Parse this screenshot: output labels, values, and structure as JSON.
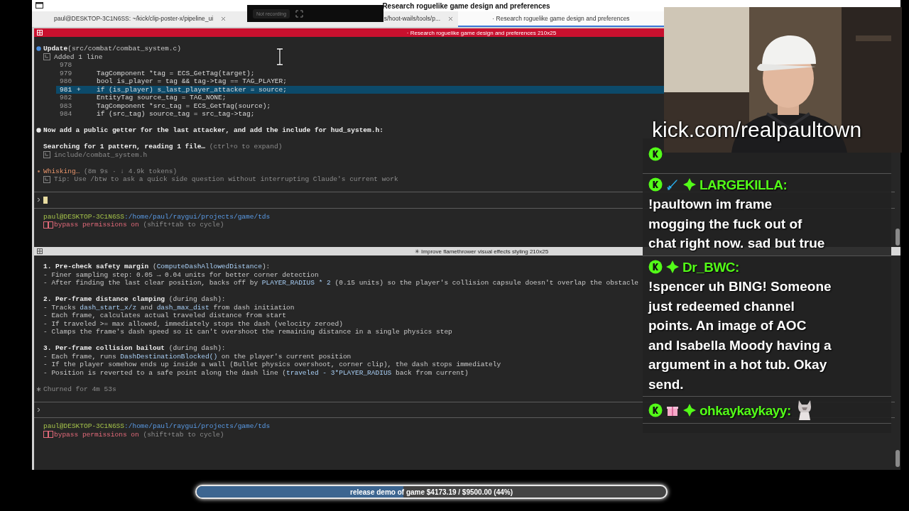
{
  "window": {
    "title": "Research roguelike game design and preferences"
  },
  "tabs": [
    {
      "label": "paul@DESKTOP-3C1N6SS: ~/kick/clip-poster-x/pipeline_ui",
      "selected": false
    },
    {
      "label": "s/hoot-wails/tools/p...",
      "selected": false
    },
    {
      "label": "· Research roguelike game design and preferences",
      "selected": true
    }
  ],
  "recorder": {
    "label": "Not recording"
  },
  "panes": [
    {
      "header": {
        "title": "· Research roguelike game design and preferences 210x25",
        "active": true
      },
      "lines": [
        {
          "kind": "text",
          "bullet": {
            "kind": "tool"
          },
          "segs": [
            {
              "text": "Update",
              "kind": "bold"
            },
            {
              "text": "(src/combat/combat_system.c)",
              "kind": "plain"
            }
          ]
        },
        {
          "kind": "sub",
          "segs": [
            {
              "text": "Added 1 line",
              "kind": "plain"
            }
          ]
        },
        {
          "kind": "diff",
          "num": "978",
          "added": false
        },
        {
          "kind": "diff",
          "num": "979",
          "code": "TagComponent *tag = ECS_GetTag(target);",
          "added": false
        },
        {
          "kind": "diff",
          "num": "980",
          "code": "bool is_player = tag && tag->tag == TAG_PLAYER;",
          "added": false
        },
        {
          "kind": "diff",
          "num": "981",
          "sign": "+",
          "code": "if (is_player) s_last_player_attacker = source;",
          "added": true
        },
        {
          "kind": "diff",
          "num": "982",
          "code": "EntityTag source_tag = TAG_NONE;",
          "added": false
        },
        {
          "kind": "diff",
          "num": "983",
          "code": "TagComponent *src_tag = ECS_GetTag(source);",
          "added": false
        },
        {
          "kind": "diff",
          "num": "984",
          "code": "if (src_tag) source_tag = src_tag->tag;",
          "added": false
        },
        {
          "kind": "blank"
        },
        {
          "kind": "text",
          "bullet": {
            "kind": "reply"
          },
          "segs": [
            {
              "text": "Now add a public getter for the last attacker, and add the include for hud_system.h:",
              "kind": "bold"
            }
          ]
        },
        {
          "kind": "blank"
        },
        {
          "kind": "text",
          "segs": [
            {
              "text": "Searching for 1 pattern, reading 1 file…",
              "kind": "bold"
            },
            {
              "text": " (ctrl+o to expand)",
              "kind": "dim"
            }
          ]
        },
        {
          "kind": "sub",
          "segs": [
            {
              "text": "include/combat_system.h",
              "kind": "dim"
            }
          ]
        },
        {
          "kind": "blank"
        },
        {
          "kind": "text",
          "bullet": {
            "kind": "working"
          },
          "segs": [
            {
              "text": "Whisking…",
              "kind": "warn"
            },
            {
              "text": " (8m 9s · ↓ 4.9k tokens)",
              "kind": "dim"
            }
          ]
        },
        {
          "kind": "sub",
          "segs": [
            {
              "text": "Tip: Use /btw to ask a quick side question without interrupting Claude's current work",
              "kind": "dim"
            }
          ]
        },
        {
          "kind": "blank"
        }
      ],
      "input": {
        "cursor": true
      },
      "prompt": [
        {
          "text": "paul@DESKTOP-3C1N6SS",
          "kind": "host"
        },
        {
          "text": ":/home/paul/raygui/projects/game/tds",
          "kind": "path"
        }
      ],
      "mode": [
        {
          "text": "bypass permissions on",
          "kind": "alert"
        },
        {
          "text": " (shift+tab to cycle)",
          "kind": "dim"
        }
      ]
    },
    {
      "header": {
        "title": "✳ Improve flamethrower visual effects styling 210x25",
        "active": false
      },
      "lines": [
        {
          "kind": "text",
          "segs": [
            {
              "text": "1. Pre-check safety margin",
              "kind": "bold"
            },
            {
              "text": " (",
              "kind": "plain"
            },
            {
              "text": "ComputeDashAllowedDistance",
              "kind": "ident"
            },
            {
              "text": "):",
              "kind": "plain"
            }
          ]
        },
        {
          "kind": "text",
          "segs": [
            {
              "text": "- Finer sampling step: 0.05 → 0.04 units for better corner detection",
              "kind": "plain"
            }
          ]
        },
        {
          "kind": "text",
          "segs": [
            {
              "text": "- After finding the last clear position, backs off by ",
              "kind": "plain"
            },
            {
              "text": "PLAYER_RADIUS * 2",
              "kind": "ident"
            },
            {
              "text": " (0.15 units) so the player's collision capsule doesn't overlap the obstacle",
              "kind": "plain"
            }
          ]
        },
        {
          "kind": "blank"
        },
        {
          "kind": "text",
          "segs": [
            {
              "text": "2. Per-frame distance clamping",
              "kind": "bold"
            },
            {
              "text": " (during dash):",
              "kind": "plain"
            }
          ]
        },
        {
          "kind": "text",
          "segs": [
            {
              "text": "- Tracks ",
              "kind": "plain"
            },
            {
              "text": "dash_start_x/z",
              "kind": "ident"
            },
            {
              "text": " and ",
              "kind": "plain"
            },
            {
              "text": "dash_max_dist",
              "kind": "ident"
            },
            {
              "text": " from dash initiation",
              "kind": "plain"
            }
          ]
        },
        {
          "kind": "text",
          "segs": [
            {
              "text": "- Each frame, calculates actual traveled distance from start",
              "kind": "plain"
            }
          ]
        },
        {
          "kind": "text",
          "segs": [
            {
              "text": "- If traveled >= max allowed, immediately stops the dash (velocity zeroed)",
              "kind": "plain"
            }
          ]
        },
        {
          "kind": "text",
          "segs": [
            {
              "text": "- Clamps the frame's dash speed so it can't overshoot the remaining distance in a single physics step",
              "kind": "plain"
            }
          ]
        },
        {
          "kind": "blank"
        },
        {
          "kind": "text",
          "segs": [
            {
              "text": "3. Per-frame collision bailout",
              "kind": "bold"
            },
            {
              "text": " (during dash):",
              "kind": "plain"
            }
          ]
        },
        {
          "kind": "text",
          "segs": [
            {
              "text": "- Each frame, runs ",
              "kind": "plain"
            },
            {
              "text": "DashDestinationBlocked()",
              "kind": "ident"
            },
            {
              "text": " on the player's current position",
              "kind": "plain"
            }
          ]
        },
        {
          "kind": "text",
          "segs": [
            {
              "text": "- If the player somehow ends up inside a wall (Bullet physics overshoot, corner clip), the dash stops immediately",
              "kind": "plain"
            }
          ]
        },
        {
          "kind": "text",
          "segs": [
            {
              "text": "- Position is reverted to a safe point along the dash line (",
              "kind": "plain"
            },
            {
              "text": "traveled - 3*PLAYER_RADIUS",
              "kind": "ident"
            },
            {
              "text": " back from current)",
              "kind": "plain"
            }
          ]
        },
        {
          "kind": "blank"
        },
        {
          "kind": "text",
          "bullet": {
            "kind": "done"
          },
          "segs": [
            {
              "text": "Churned for 4m 53s",
              "kind": "dim"
            }
          ]
        },
        {
          "kind": "blank"
        }
      ],
      "input": {
        "cursor": false
      },
      "prompt": [
        {
          "text": "paul@DESKTOP-3C1N6SS",
          "kind": "host"
        },
        {
          "text": ":/home/paul/raygui/projects/game/tds",
          "kind": "path"
        }
      ],
      "mode": [
        {
          "text": "bypass permissions on",
          "kind": "alert"
        },
        {
          "text": " (shift+tab to cycle)",
          "kind": "dim"
        }
      ]
    }
  ],
  "webcam": {
    "kind": "picture",
    "caption": "kick.com/realpaultown"
  },
  "chat": {
    "messages": [
      {
        "badges": [
          {
            "kind": "kick"
          }
        ]
      },
      {
        "badges": [
          {
            "kind": "kick"
          },
          {
            "kind": "sword"
          },
          {
            "kind": "gem"
          }
        ],
        "user": "LARGEKILLA:",
        "text": "!paultown im frame mogging the fuck out of chat right now. sad but true"
      },
      {
        "badges": [
          {
            "kind": "kick"
          },
          {
            "kind": "gem"
          }
        ],
        "user": "Dr_BWC:",
        "text": "!spencer uh BING! Someone just redeemed channel points. An image of AOC and Isabella Moody having a argument in a hot tub. Okay send."
      },
      {
        "badges": [
          {
            "kind": "kick"
          },
          {
            "kind": "gift"
          },
          {
            "kind": "gem"
          }
        ],
        "user": "ohkaykaykayy:",
        "emote": {
          "kind": "cat"
        }
      }
    ]
  },
  "goal": {
    "label": "release demo of game $4173.19 / $9500.00 (44%)",
    "level": 0.44
  }
}
